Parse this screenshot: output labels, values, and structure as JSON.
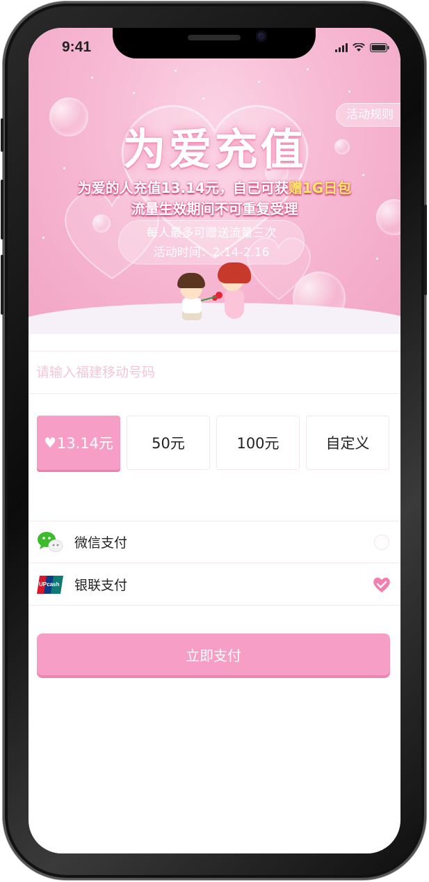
{
  "status_bar": {
    "time": "9:41"
  },
  "banner": {
    "rules_button": "活动规则",
    "title": "为爱充值",
    "line1_prefix": "为爱的人充值13.14元，自己可获",
    "line1_highlight": "赠1G日包",
    "line2": "流量生效期间不可重复受理",
    "info_line1": "每人最多可赠送流量三次",
    "info_line2": "活动时间：2.14-2.16"
  },
  "form": {
    "phone_placeholder": "请输入福建移动号码",
    "phone_value": "",
    "amounts": [
      {
        "label": "13.14元",
        "selected": true,
        "icon": "heart-icon"
      },
      {
        "label": "50元",
        "selected": false
      },
      {
        "label": "100元",
        "selected": false
      },
      {
        "label": "自定义",
        "selected": false
      }
    ],
    "payment_methods": [
      {
        "label": "微信支付",
        "icon": "wechat-icon",
        "selected": false
      },
      {
        "label": "银联支付",
        "icon": "unionpay-icon",
        "selected": true
      }
    ],
    "submit_label": "立即支付"
  },
  "colors": {
    "accent": "#f79ec6",
    "accent_shadow": "#ec7fae",
    "placeholder": "#f4c6d8",
    "highlight_text": "#ffe86a"
  }
}
